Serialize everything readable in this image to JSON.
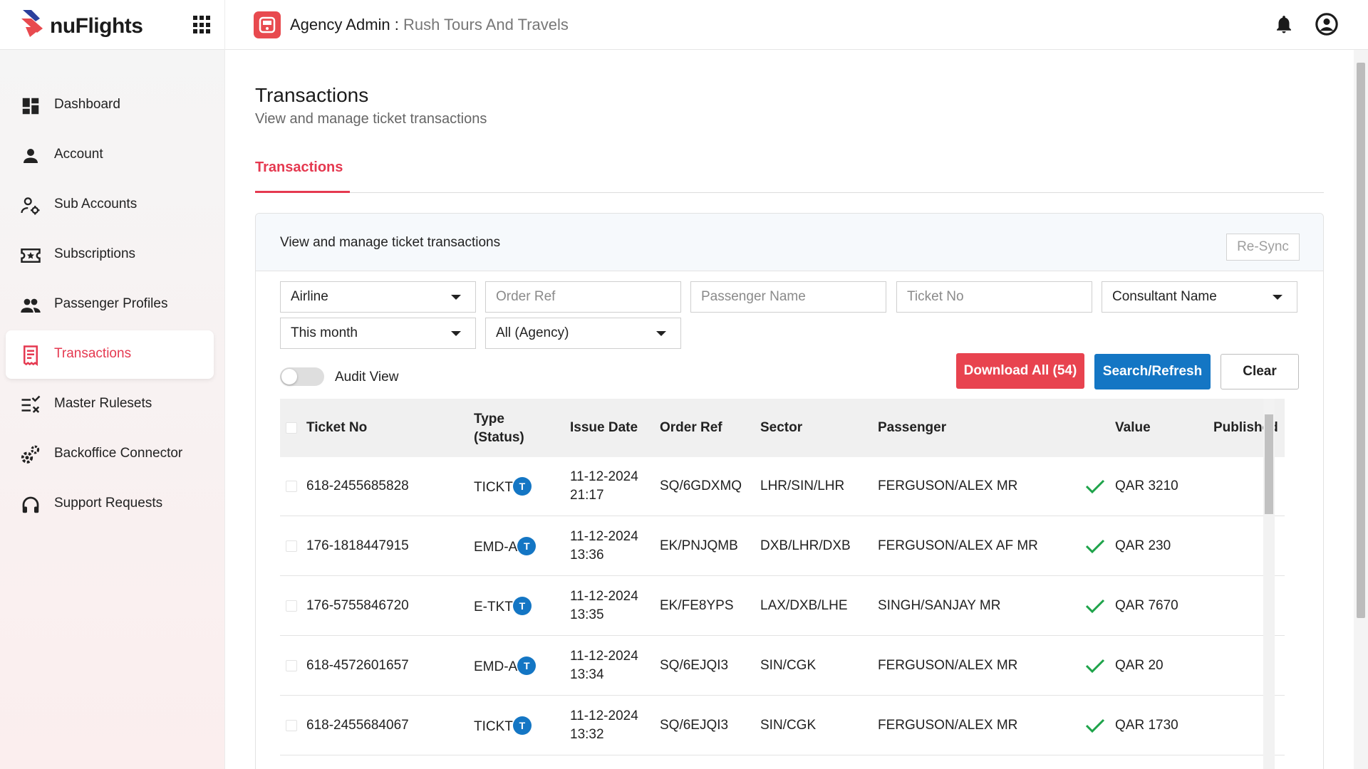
{
  "brand": {
    "name": "nuFlights"
  },
  "header": {
    "role": "Agency Admin",
    "separator": " : ",
    "agency": "Rush Tours And Travels"
  },
  "sidebar": {
    "items": [
      {
        "label": "Dashboard",
        "icon": "dashboard-icon"
      },
      {
        "label": "Account",
        "icon": "person-icon"
      },
      {
        "label": "Sub Accounts",
        "icon": "user-settings-icon"
      },
      {
        "label": "Subscriptions",
        "icon": "ticket-star-icon"
      },
      {
        "label": "Passenger Profiles",
        "icon": "people-icon"
      },
      {
        "label": "Transactions",
        "icon": "receipt-icon",
        "active": true
      },
      {
        "label": "Master Rulesets",
        "icon": "rules-list-icon"
      },
      {
        "label": "Backoffice Connector",
        "icon": "gears-icon"
      },
      {
        "label": "Support Requests",
        "icon": "headset-icon"
      }
    ]
  },
  "main": {
    "title": "Transactions",
    "subtitle": "View and manage ticket transactions",
    "tab": "Transactions",
    "card_title": "View and manage ticket transactions",
    "resync": "Re-Sync"
  },
  "filters": {
    "airline": "Airline",
    "order_ref_placeholder": "Order Ref",
    "passenger_placeholder": "Passenger Name",
    "ticket_placeholder": "Ticket No",
    "consultant": "Consultant Name",
    "period": "This month",
    "agency": "All (Agency)",
    "audit_view": "Audit View"
  },
  "buttons": {
    "download": "Download All (54)",
    "search": "Search/Refresh",
    "clear": "Clear"
  },
  "table": {
    "headers": {
      "ticket": "Ticket No",
      "type_1": "Type",
      "type_2": "(Status)",
      "issue": "Issue Date",
      "order": "Order Ref",
      "sector": "Sector",
      "passenger": "Passenger",
      "value": "Value",
      "published": "Published"
    },
    "rows": [
      {
        "ticket": "618-2455685828",
        "type": "TICKT",
        "status": "T",
        "date": "11-12-2024",
        "time": "21:17",
        "order": "SQ/6GDXMQ",
        "sector": "LHR/SIN/LHR",
        "passenger": "FERGUSON/ALEX MR",
        "value": "QAR 3210",
        "published": true
      },
      {
        "ticket": "176-1818447915",
        "type": "EMD-A",
        "status": "T",
        "date": "11-12-2024",
        "time": "13:36",
        "order": "EK/PNJQMB",
        "sector": "DXB/LHR/DXB",
        "passenger": "FERGUSON/ALEX AF MR",
        "value": "QAR 230",
        "published": true
      },
      {
        "ticket": "176-5755846720",
        "type": "E-TKT",
        "status": "T",
        "date": "11-12-2024",
        "time": "13:35",
        "order": "EK/FE8YPS",
        "sector": "LAX/DXB/LHE",
        "passenger": "SINGH/SANJAY MR",
        "value": "QAR 7670",
        "published": true
      },
      {
        "ticket": "618-4572601657",
        "type": "EMD-A",
        "status": "T",
        "date": "11-12-2024",
        "time": "13:34",
        "order": "SQ/6EJQI3",
        "sector": "SIN/CGK",
        "passenger": "FERGUSON/ALEX MR",
        "value": "QAR 20",
        "published": true
      },
      {
        "ticket": "618-2455684067",
        "type": "TICKT",
        "status": "T",
        "date": "11-12-2024",
        "time": "13:32",
        "order": "SQ/6EJQI3",
        "sector": "SIN/CGK",
        "passenger": "FERGUSON/ALEX MR",
        "value": "QAR 1730",
        "published": true
      }
    ]
  },
  "colors": {
    "accent": "#e53950",
    "primary": "#1476c4",
    "success": "#1ea34a"
  }
}
